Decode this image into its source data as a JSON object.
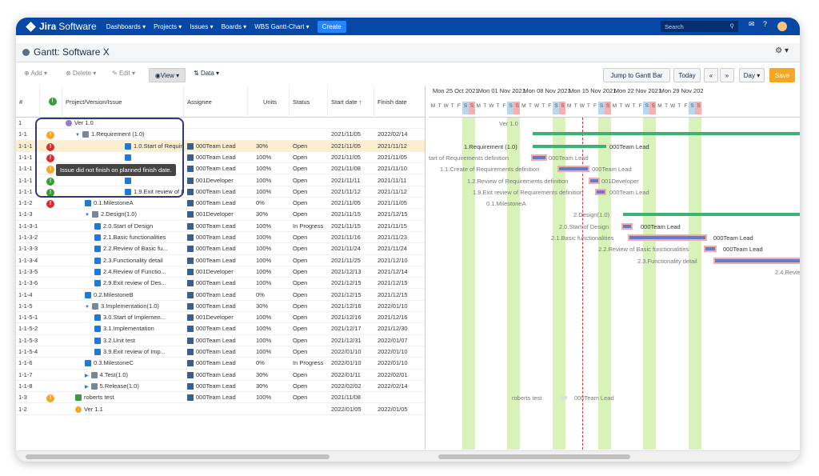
{
  "nav": {
    "app": "Jira",
    "app2": "Software",
    "items": [
      "Dashboards ▾",
      "Projects ▾",
      "Issues ▾",
      "Boards ▾",
      "WBS Gantt-Chart ▾"
    ],
    "create": "Create",
    "search": "Search"
  },
  "header": {
    "title": "Gantt:  Software X"
  },
  "toolbar": {
    "add": "Add ▾",
    "delete": "Delete ▾",
    "edit": "Edit ▾",
    "view": "View ▾",
    "data": "Data ▾",
    "jump": "Jump to Gantt Bar",
    "today": "Today",
    "prev": "«",
    "next": "»",
    "scale": "Day ▾",
    "save": "Save"
  },
  "columns": [
    "#",
    "",
    "Project/Version/Issue",
    "Assignee",
    "Units",
    "Status",
    "Start date ↑",
    "Finish date"
  ],
  "tooltip": "Issue did not finish on planned finish date.",
  "rows": [
    {
      "no": "1",
      "name": "Ver 1.0",
      "assignee": "",
      "units": "",
      "status": "",
      "start": "",
      "finish": ""
    },
    {
      "no": "1-1",
      "name": "1.Requirement (1.0)",
      "assignee": "",
      "units": "",
      "status": "",
      "start": "2021/11/05",
      "finish": "2022/02/14"
    },
    {
      "no": "1-1-1",
      "name": "1.0.Start of Requirem...",
      "assignee": "000Team Lead",
      "units": "30%",
      "status": "Open",
      "start": "2021/11/05",
      "finish": "2021/11/12"
    },
    {
      "no": "1-1-1",
      "name": "",
      "assignee": "000Team Lead",
      "units": "100%",
      "status": "Open",
      "start": "2021/11/05",
      "finish": "2021/11/05"
    },
    {
      "no": "1-1-1",
      "name": "",
      "assignee": "000Team Lead",
      "units": "100%",
      "status": "Open",
      "start": "2021/11/08",
      "finish": "2021/11/10"
    },
    {
      "no": "1-1-1",
      "name": "",
      "assignee": "001Developer",
      "units": "100%",
      "status": "Open",
      "start": "2021/11/11",
      "finish": "2021/11/11"
    },
    {
      "no": "1-1-1",
      "name": "1.9.Exit review of Req...",
      "assignee": "000Team Lead",
      "units": "100%",
      "status": "Open",
      "start": "2021/11/12",
      "finish": "2021/11/12"
    },
    {
      "no": "1-1-2",
      "name": "0.1.MilestoneA",
      "assignee": "000Team Lead",
      "units": "0%",
      "status": "Open",
      "start": "2021/11/05",
      "finish": "2021/11/05"
    },
    {
      "no": "1-1-3",
      "name": "2.Design(1.0)",
      "assignee": "001Developer",
      "units": "30%",
      "status": "Open",
      "start": "2021/11/15",
      "finish": "2021/12/15"
    },
    {
      "no": "1-1-3-1",
      "name": "2.0.Start of Design",
      "assignee": "000Team Lead",
      "units": "100%",
      "status": "In Progress",
      "start": "2021/11/15",
      "finish": "2021/11/15"
    },
    {
      "no": "1-1-3-2",
      "name": "2.1.Basic functionalities",
      "assignee": "000Team Lead",
      "units": "100%",
      "status": "Open",
      "start": "2021/11/16",
      "finish": "2021/11/23"
    },
    {
      "no": "1-1-3-3",
      "name": "2.2.Review of Basic fu...",
      "assignee": "000Team Lead",
      "units": "100%",
      "status": "Open",
      "start": "2021/11/24",
      "finish": "2021/11/24"
    },
    {
      "no": "1-1-3-4",
      "name": "2.3.Functionality detail",
      "assignee": "000Team Lead",
      "units": "100%",
      "status": "Open",
      "start": "2021/11/25",
      "finish": "2021/12/10"
    },
    {
      "no": "1-1-3-5",
      "name": "2.4.Review of Functio...",
      "assignee": "001Developer",
      "units": "100%",
      "status": "Open",
      "start": "2021/12/13",
      "finish": "2021/12/14"
    },
    {
      "no": "1-1-3-6",
      "name": "2.9.Exit review of Des...",
      "assignee": "000Team Lead",
      "units": "100%",
      "status": "Open",
      "start": "2021/12/15",
      "finish": "2021/12/15"
    },
    {
      "no": "1-1-4",
      "name": "0.2.MilestoneB",
      "assignee": "000Team Lead",
      "units": "0%",
      "status": "Open",
      "start": "2021/12/15",
      "finish": "2021/12/15"
    },
    {
      "no": "1-1-5",
      "name": "3.Implementation(1.0)",
      "assignee": "000Team Lead",
      "units": "30%",
      "status": "Open",
      "start": "2021/12/16",
      "finish": "2022/01/10"
    },
    {
      "no": "1-1-5-1",
      "name": "3.0.Start of Implemen...",
      "assignee": "001Developer",
      "units": "100%",
      "status": "Open",
      "start": "2021/12/16",
      "finish": "2021/12/16"
    },
    {
      "no": "1-1-5-2",
      "name": "3.1.Implementation",
      "assignee": "000Team Lead",
      "units": "100%",
      "status": "Open",
      "start": "2021/12/17",
      "finish": "2021/12/30"
    },
    {
      "no": "1-1-5-3",
      "name": "3.2.Unit test",
      "assignee": "000Team Lead",
      "units": "100%",
      "status": "Open",
      "start": "2021/12/31",
      "finish": "2022/01/07"
    },
    {
      "no": "1-1-5-4",
      "name": "3.9.Exit review of Imp...",
      "assignee": "000Team Lead",
      "units": "100%",
      "status": "Open",
      "start": "2022/01/10",
      "finish": "2022/01/10"
    },
    {
      "no": "1-1-6",
      "name": "0.3.MilestoneC",
      "assignee": "000Team Lead",
      "units": "0%",
      "status": "In Progress",
      "start": "2022/01/10",
      "finish": "2022/01/10"
    },
    {
      "no": "1-1-7",
      "name": "4.Test(1.0)",
      "assignee": "000Team Lead",
      "units": "30%",
      "status": "Open",
      "start": "2022/01/11",
      "finish": "2022/02/01"
    },
    {
      "no": "1-1-8",
      "name": "5.Release(1.0)",
      "assignee": "000Team Lead",
      "units": "30%",
      "status": "Open",
      "start": "2022/02/02",
      "finish": "2022/02/14"
    },
    {
      "no": "1-3",
      "name": "roberts test",
      "assignee": "000Team Lead",
      "units": "100%",
      "status": "Open",
      "start": "2021/11/08",
      "finish": ""
    },
    {
      "no": "1-2",
      "name": "Ver 1.1",
      "assignee": "",
      "units": "",
      "status": "",
      "start": "2022/01/05",
      "finish": "2022/01/05"
    }
  ],
  "weeks": [
    "Mon 25 Oct 2021",
    "Mon 01 Nov 2021",
    "Mon 08 Nov 2021",
    "Mon 15 Nov 2021",
    "Mon 22 Nov 2021",
    "Mon 29 Nov 202"
  ],
  "days": [
    "M",
    "T",
    "W",
    "T",
    "F",
    "S",
    "S"
  ],
  "gantt_labels": {
    "ver": "Ver 1.0",
    "req": "1.Requirement (1.0)",
    "req_res": "000Team Lead",
    "start_req": "tart of Requirements definition",
    "start_req_res": "000Team Lead",
    "create": "1.1.Create of Requirements definition",
    "create_res": "000Team Lead",
    "review": "1.2.Review of Requirements definition",
    "review_res": "001Developer",
    "exit": "1.9.Exit review of Requirements definition",
    "exit_res": "000Team Lead",
    "msa": "0.1.MilestoneA",
    "design": "2.Design(1.0)",
    "start_design": "2.0.Start of Design",
    "start_design_res": "000Team Lead",
    "basic": "2.1.Basic functionalities",
    "basic_res": "000Team Lead",
    "review_basic": "2.2.Review of Basic functionalities",
    "review_basic_res": "000Team Lead",
    "func": "2.3.Functionality detail",
    "rev_func": "2.4.Revie",
    "roberts": "roberts test",
    "roberts_res": "000Team Lead"
  }
}
